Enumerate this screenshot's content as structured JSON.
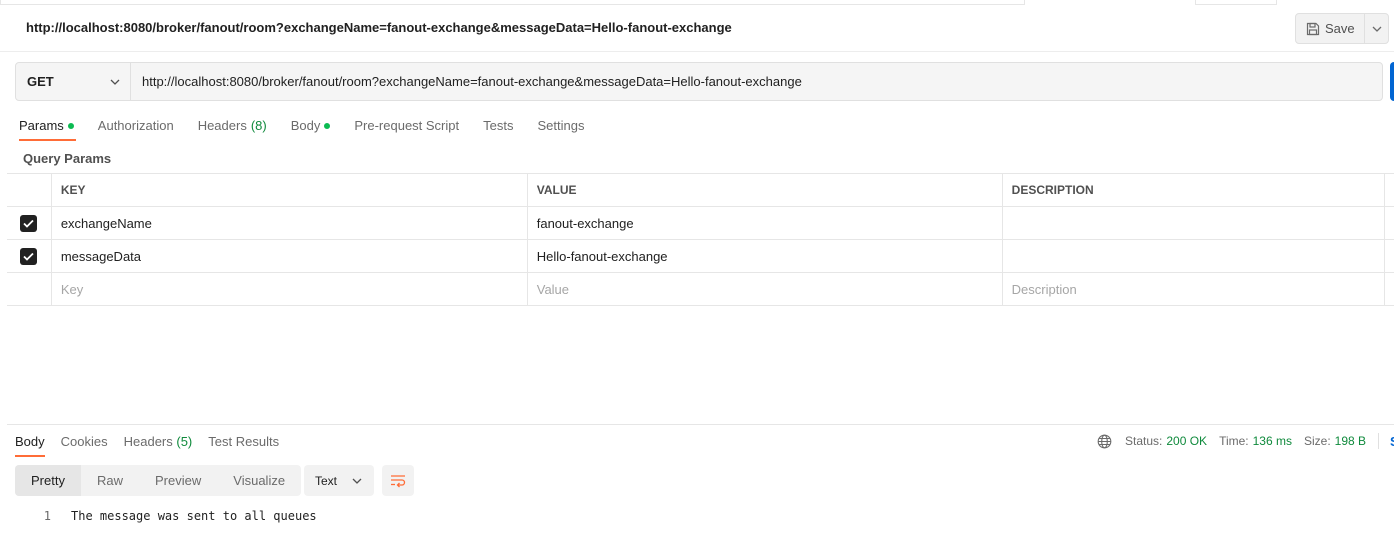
{
  "request": {
    "title": "http://localhost:8080/broker/fanout/room?exchangeName=fanout-exchange&messageData=Hello-fanout-exchange",
    "save_label": "Save",
    "method": "GET",
    "url": "http://localhost:8080/broker/fanout/room?exchangeName=fanout-exchange&messageData=Hello-fanout-exchange"
  },
  "request_tabs": [
    {
      "label": "Params",
      "active": true,
      "dot": true
    },
    {
      "label": "Authorization"
    },
    {
      "label": "Headers",
      "count": "(8)"
    },
    {
      "label": "Body",
      "dot": true
    },
    {
      "label": "Pre-request Script"
    },
    {
      "label": "Tests"
    },
    {
      "label": "Settings"
    }
  ],
  "query_params": {
    "label": "Query Params",
    "headers": {
      "key": "KEY",
      "value": "VALUE",
      "description": "DESCRIPTION"
    },
    "rows": [
      {
        "key": "exchangeName",
        "value": "fanout-exchange",
        "description": "",
        "checked": true
      },
      {
        "key": "messageData",
        "value": "Hello-fanout-exchange",
        "description": "",
        "checked": true
      }
    ],
    "placeholders": {
      "key": "Key",
      "value": "Value",
      "description": "Description"
    }
  },
  "response_tabs": [
    {
      "label": "Body",
      "active": true
    },
    {
      "label": "Cookies"
    },
    {
      "label": "Headers",
      "count": "(5)"
    },
    {
      "label": "Test Results"
    }
  ],
  "status": {
    "status_label": "Status:",
    "status_value": "200 OK",
    "time_label": "Time:",
    "time_value": "136 ms",
    "size_label": "Size:",
    "size_value": "198 B",
    "save_response": "Sa"
  },
  "format": {
    "modes": [
      "Pretty",
      "Raw",
      "Preview",
      "Visualize"
    ],
    "active": "Pretty",
    "language": "Text"
  },
  "response_body": [
    {
      "line": "1",
      "text": "The message was sent to all queues"
    }
  ],
  "colors": {
    "accent": "#ff6c37",
    "success": "#0f8a3c",
    "dot": "#0cbb52",
    "send": "#0265d2"
  }
}
